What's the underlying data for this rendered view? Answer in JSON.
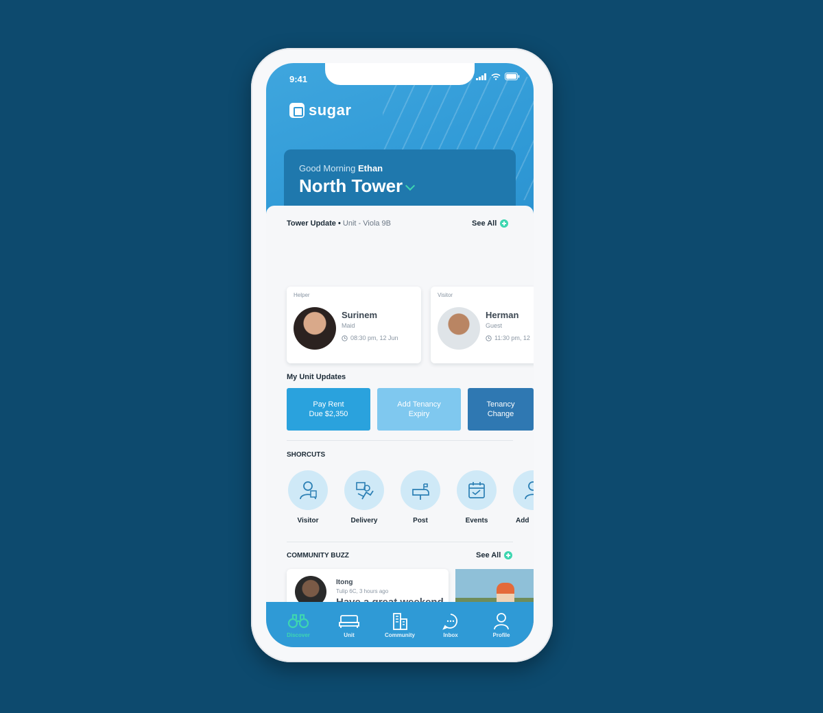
{
  "status_bar": {
    "time": "9:41"
  },
  "app": {
    "name": "sugar"
  },
  "header": {
    "greeting": "Good Morning",
    "user_name": "Ethan",
    "tower": "North Tower"
  },
  "tower_update": {
    "title": "Tower Update",
    "separator": "•",
    "unit": "Unit - Viola 9B",
    "see_all": "See All",
    "people": [
      {
        "role": "Helper",
        "name": "Surinem",
        "relation": "Maid",
        "time": "08:30 pm, 12 Jun"
      },
      {
        "role": "Visitor",
        "name": "Herman",
        "relation": "Guest",
        "time": "11:30 pm, 12"
      }
    ]
  },
  "unit_updates": {
    "title": "My Unit Updates",
    "buttons": [
      {
        "line1": "Pay Rent",
        "line2": "Due $2,350"
      },
      {
        "line1": "Add Tenancy",
        "line2": "Expiry"
      },
      {
        "line1": "Tenancy",
        "line2": "Change"
      }
    ]
  },
  "shortcuts": {
    "title": "SHORCUTS",
    "items": [
      {
        "label": "Visitor",
        "icon": "visitor-icon"
      },
      {
        "label": "Delivery",
        "icon": "delivery-icon"
      },
      {
        "label": "Post",
        "icon": "post-icon"
      },
      {
        "label": "Events",
        "icon": "events-icon"
      },
      {
        "label": "Add",
        "icon": "add-icon"
      }
    ]
  },
  "community": {
    "title": "COMMUNITY BUZZ",
    "see_all": "See All",
    "post": {
      "user": "Itong",
      "time": "Tulip 6C, 3 hours ago",
      "text": "Have a great weekend everyone!"
    }
  },
  "tabbar": {
    "items": [
      {
        "label": "Discover",
        "icon": "binoculars-icon",
        "active": true
      },
      {
        "label": "Unit",
        "icon": "bed-icon",
        "active": false
      },
      {
        "label": "Community",
        "icon": "building-icon",
        "active": false
      },
      {
        "label": "Inbox",
        "icon": "chat-icon",
        "active": false
      },
      {
        "label": "Profile",
        "icon": "person-icon",
        "active": false
      }
    ]
  },
  "colors": {
    "background": "#0d4a6e",
    "hero": "#2f99d6",
    "greeting_card": "#1f78ad",
    "accent": "#3ed6b0",
    "unit_btn_1": "#2aa2dd",
    "unit_btn_2": "#7fc8ef",
    "unit_btn_3": "#2f78b2"
  }
}
